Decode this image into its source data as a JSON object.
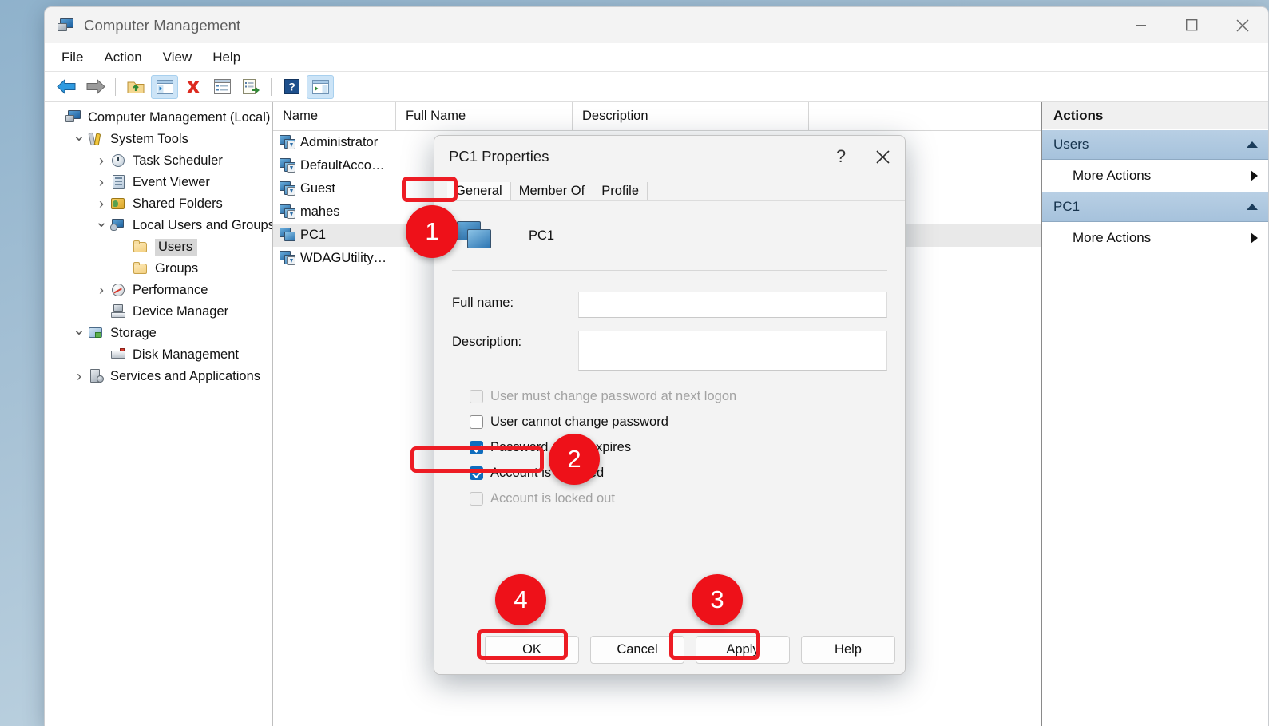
{
  "window": {
    "title": "Computer Management",
    "app_icon": "computer-management-icon",
    "minimize": "minimize-icon",
    "maximize": "maximize-icon",
    "close": "close-icon"
  },
  "menubar": {
    "items": [
      "File",
      "Action",
      "View",
      "Help"
    ]
  },
  "toolbar": {
    "items": [
      {
        "name": "back-icon"
      },
      {
        "name": "forward-icon"
      },
      {
        "name": "up-folder-icon"
      },
      {
        "name": "show-hide-console-tree-icon",
        "selected": true
      },
      {
        "name": "delete-icon"
      },
      {
        "name": "properties-icon"
      },
      {
        "name": "export-list-icon"
      },
      {
        "name": "help-icon"
      },
      {
        "name": "show-hide-action-pane-icon",
        "selected": true
      }
    ]
  },
  "tree": {
    "items": [
      {
        "label": "Computer Management (Local)",
        "indent": 0,
        "chevron": "none",
        "icon": "computer-icon",
        "selected": false
      },
      {
        "label": "System Tools",
        "indent": 1,
        "chevron": "down",
        "icon": "system-tools-icon",
        "selected": false
      },
      {
        "label": "Task Scheduler",
        "indent": 2,
        "chevron": "right",
        "icon": "task-scheduler-icon",
        "selected": false
      },
      {
        "label": "Event Viewer",
        "indent": 2,
        "chevron": "right",
        "icon": "event-viewer-icon",
        "selected": false
      },
      {
        "label": "Shared Folders",
        "indent": 2,
        "chevron": "right",
        "icon": "shared-folders-icon",
        "selected": false
      },
      {
        "label": "Local Users and Groups",
        "indent": 2,
        "chevron": "down",
        "icon": "local-users-groups-icon",
        "selected": false
      },
      {
        "label": "Users",
        "indent": 3,
        "chevron": "none",
        "icon": "folder-icon",
        "selected": true
      },
      {
        "label": "Groups",
        "indent": 3,
        "chevron": "none",
        "icon": "folder-icon",
        "selected": false
      },
      {
        "label": "Performance",
        "indent": 2,
        "chevron": "right",
        "icon": "performance-icon",
        "selected": false
      },
      {
        "label": "Device Manager",
        "indent": 2,
        "chevron": "none",
        "icon": "device-manager-icon",
        "selected": false
      },
      {
        "label": "Storage",
        "indent": 1,
        "chevron": "down",
        "icon": "storage-icon",
        "selected": false
      },
      {
        "label": "Disk Management",
        "indent": 2,
        "chevron": "none",
        "icon": "disk-management-icon",
        "selected": false
      },
      {
        "label": "Services and Applications",
        "indent": 1,
        "chevron": "right",
        "icon": "services-applications-icon",
        "selected": false
      }
    ]
  },
  "list": {
    "columns": [
      "Name",
      "Full Name",
      "Description",
      ""
    ],
    "rows": [
      {
        "name": "Administrator",
        "full_name": "",
        "description": "",
        "selected": false
      },
      {
        "name": "DefaultAcco…",
        "full_name": "",
        "description": "",
        "selected": false
      },
      {
        "name": "Guest",
        "full_name": "",
        "description": "",
        "selected": false
      },
      {
        "name": "mahes",
        "full_name": "",
        "description": "",
        "selected": false
      },
      {
        "name": "PC1",
        "full_name": "",
        "description": "",
        "selected": true
      },
      {
        "name": "WDAGUtility…",
        "full_name": "",
        "description": "",
        "selected": false
      }
    ]
  },
  "actions": {
    "title": "Actions",
    "groups": [
      {
        "label": "Users",
        "collapse_icon": "chevron-up-icon",
        "items": [
          {
            "label": "More Actions",
            "submenu_icon": "chevron-right-icon"
          }
        ]
      },
      {
        "label": "PC1",
        "collapse_icon": "chevron-up-icon",
        "items": [
          {
            "label": "More Actions",
            "submenu_icon": "chevron-right-icon"
          }
        ]
      }
    ]
  },
  "dialog": {
    "title": "PC1 Properties",
    "help_icon": "question-mark-icon",
    "close_icon": "close-icon",
    "tabs": [
      {
        "label": "General",
        "active": true
      },
      {
        "label": "Member Of",
        "active": false
      },
      {
        "label": "Profile",
        "active": false
      }
    ],
    "account_icon": "user-account-icon",
    "account_name": "PC1",
    "fields": [
      {
        "label": "Full name:",
        "value": "",
        "placeholder": "",
        "tall": false
      },
      {
        "label": "Description:",
        "value": "",
        "placeholder": "",
        "tall": true
      }
    ],
    "checkboxes": [
      {
        "label": "User must change password at next logon",
        "checked": false,
        "disabled": true
      },
      {
        "label": "User cannot change password",
        "checked": false,
        "disabled": false
      },
      {
        "label": "Password never expires",
        "checked": true,
        "disabled": false
      },
      {
        "label": "Account is disabled",
        "checked": true,
        "disabled": false
      },
      {
        "label": "Account is locked out",
        "checked": false,
        "disabled": true
      }
    ],
    "buttons": [
      {
        "label": "OK"
      },
      {
        "label": "Cancel"
      },
      {
        "label": "Apply"
      },
      {
        "label": "Help"
      }
    ]
  },
  "annotations": {
    "accent_color": "#ee1119",
    "badges": [
      {
        "number": "1",
        "target": "general-tab"
      },
      {
        "number": "2",
        "target": "account-is-disabled-checkbox"
      },
      {
        "number": "3",
        "target": "apply-button"
      },
      {
        "number": "4",
        "target": "ok-button"
      }
    ]
  }
}
